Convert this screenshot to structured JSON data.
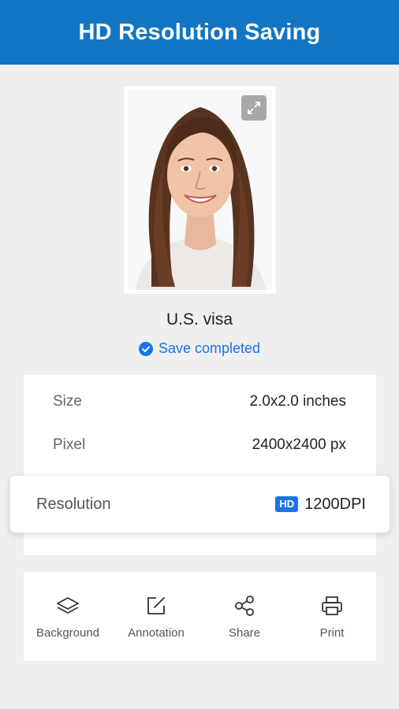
{
  "header": {
    "title": "HD Resolution Saving"
  },
  "photo": {
    "subject": "portrait photo",
    "expand_icon": "expand-icon"
  },
  "document": {
    "name": "U.S. visa"
  },
  "status": {
    "text": "Save completed",
    "icon": "check-circle-icon",
    "color": "#1a73e8"
  },
  "details": {
    "size": {
      "label": "Size",
      "value": "2.0x2.0 inches"
    },
    "pixel": {
      "label": "Pixel",
      "value": "2400x2400 px"
    },
    "resolution": {
      "label": "Resolution",
      "badge": "HD",
      "value": "1200DPI"
    }
  },
  "actions": [
    {
      "label": "Background",
      "icon": "layers-icon"
    },
    {
      "label": "Annotation",
      "icon": "edit-icon"
    },
    {
      "label": "Share",
      "icon": "share-icon"
    },
    {
      "label": "Print",
      "icon": "printer-icon"
    }
  ],
  "colors": {
    "header": "#1275c4",
    "accent": "#1a73e8",
    "background": "#efefef"
  }
}
